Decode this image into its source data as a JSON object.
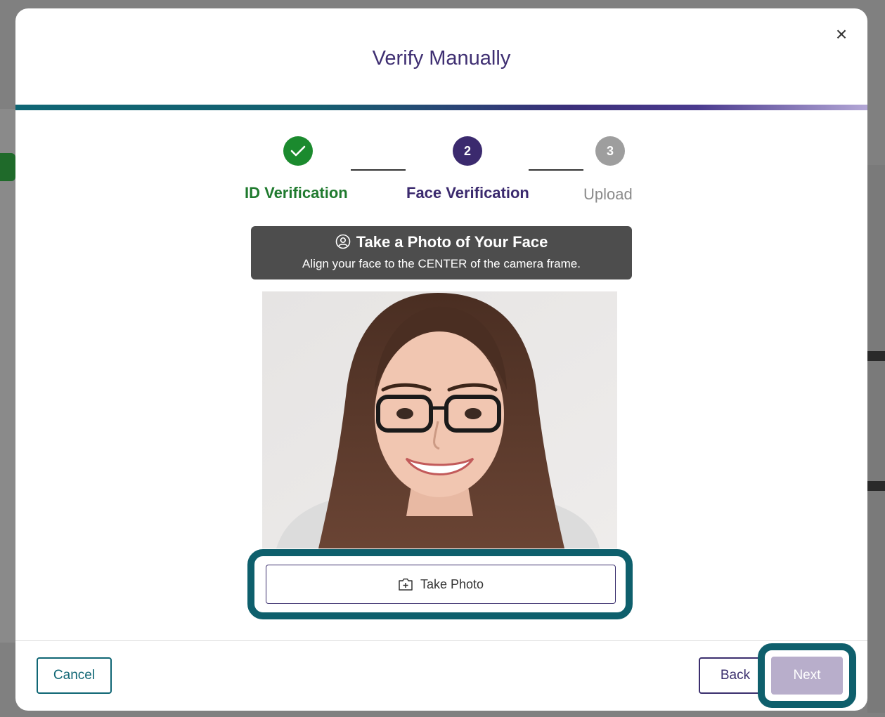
{
  "modal": {
    "title": "Verify Manually",
    "close_label": "×"
  },
  "stepper": {
    "steps": [
      {
        "number": "1",
        "label": "ID Verification",
        "state": "complete"
      },
      {
        "number": "2",
        "label": "Face Verification",
        "state": "active"
      },
      {
        "number": "3",
        "label": "Upload",
        "state": "pending"
      }
    ]
  },
  "banner": {
    "title": "Take a Photo of Your Face",
    "subtitle": "Align your face to the CENTER of the camera frame."
  },
  "photo": {
    "description_icon": "face-photo"
  },
  "actions": {
    "take_photo_label": "Take Photo",
    "cancel_label": "Cancel",
    "back_label": "Back",
    "next_label": "Next"
  },
  "colors": {
    "complete": "#1b8a2e",
    "active": "#3b2a6e",
    "pending": "#9e9e9e",
    "teal": "#0f6674",
    "next_disabled": "#b8aecb"
  }
}
